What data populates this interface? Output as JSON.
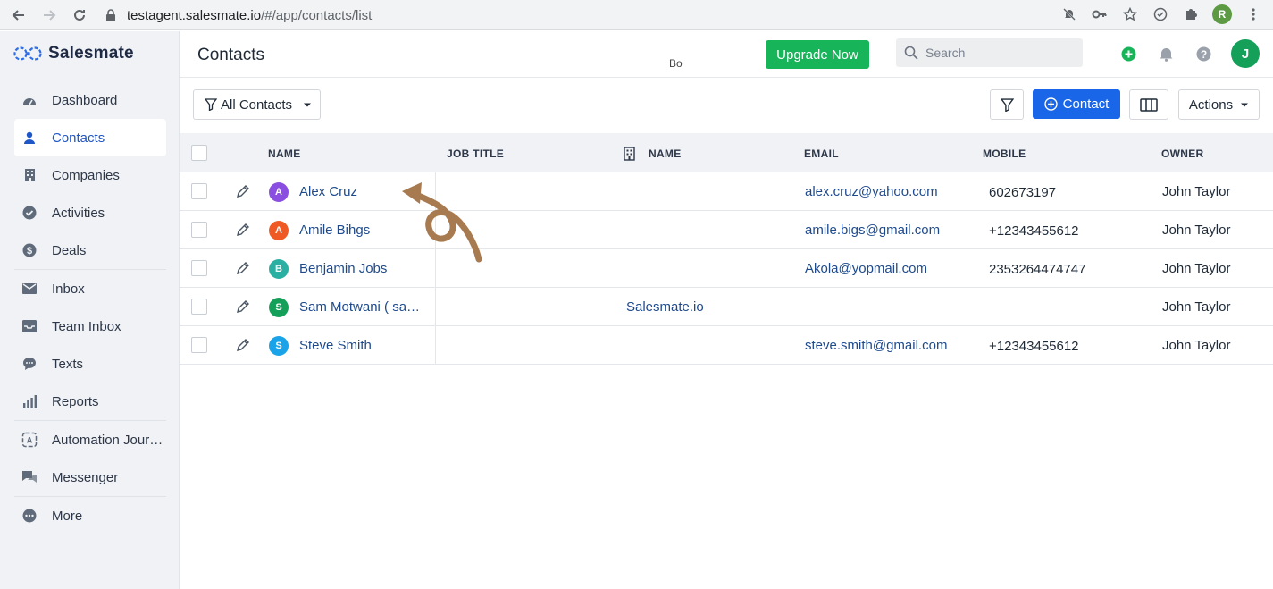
{
  "browser": {
    "url_host": "testagent.salesmate.io",
    "url_path": "/#/app/contacts/list",
    "profile_initial": "R"
  },
  "sidebar": {
    "logo_text": "Salesmate",
    "items": [
      {
        "label": "Dashboard",
        "icon": "dashboard-icon"
      },
      {
        "label": "Contacts",
        "icon": "person-icon",
        "active": true
      },
      {
        "label": "Companies",
        "icon": "building-icon"
      },
      {
        "label": "Activities",
        "icon": "check-circle-icon"
      },
      {
        "label": "Deals",
        "icon": "dollar-icon"
      },
      {
        "label": "Inbox",
        "icon": "envelope-icon"
      },
      {
        "label": "Team Inbox",
        "icon": "tray-icon"
      },
      {
        "label": "Texts",
        "icon": "chat-bubble-icon"
      },
      {
        "label": "Reports",
        "icon": "bar-chart-icon"
      },
      {
        "label": "Automation Journ...",
        "icon": "automation-icon"
      },
      {
        "label": "Messenger",
        "icon": "messenger-icon"
      },
      {
        "label": "More",
        "icon": "more-dots-icon"
      }
    ]
  },
  "header": {
    "title": "Contacts",
    "partial_text": "Bo",
    "upgrade_label": "Upgrade Now",
    "search_placeholder": "Search",
    "avatar_initial": "J"
  },
  "toolbar": {
    "view_label": "All Contacts",
    "contact_label": "Contact",
    "actions_label": "Actions"
  },
  "table": {
    "headers": {
      "name": "NAME",
      "job_title": "JOB TITLE",
      "company_name": "NAME",
      "email": "EMAIL",
      "mobile": "MOBILE",
      "owner": "OWNER"
    },
    "rows": [
      {
        "initial": "A",
        "color": "#8a4fe0",
        "name": "Alex Cruz",
        "job_title": "",
        "company": "",
        "email": "alex.cruz@yahoo.com",
        "mobile": "602673197",
        "owner": "John Taylor"
      },
      {
        "initial": "A",
        "color": "#ef5a24",
        "name": "Amile Bihgs",
        "job_title": "",
        "company": "",
        "email": "amile.bigs@gmail.com",
        "mobile": "+12343455612",
        "owner": "John Taylor"
      },
      {
        "initial": "B",
        "color": "#2ab0a3",
        "name": "Benjamin Jobs",
        "job_title": "",
        "company": "",
        "email": "Akola@yopmail.com",
        "mobile": "2353264474747",
        "owner": "John Taylor"
      },
      {
        "initial": "S",
        "color": "#15a05a",
        "name": "Sam Motwani ( sam...",
        "job_title": "",
        "company": "Salesmate.io",
        "email": "",
        "mobile": "",
        "owner": "John Taylor"
      },
      {
        "initial": "S",
        "color": "#1aa3e8",
        "name": "Steve Smith",
        "job_title": "",
        "company": "",
        "email": "steve.smith@gmail.com",
        "mobile": "+12343455612",
        "owner": "John Taylor"
      }
    ]
  },
  "colors": {
    "accent": "#1a66e8",
    "upgrade": "#18b45a",
    "annotation_arrow": "#a87a50"
  }
}
